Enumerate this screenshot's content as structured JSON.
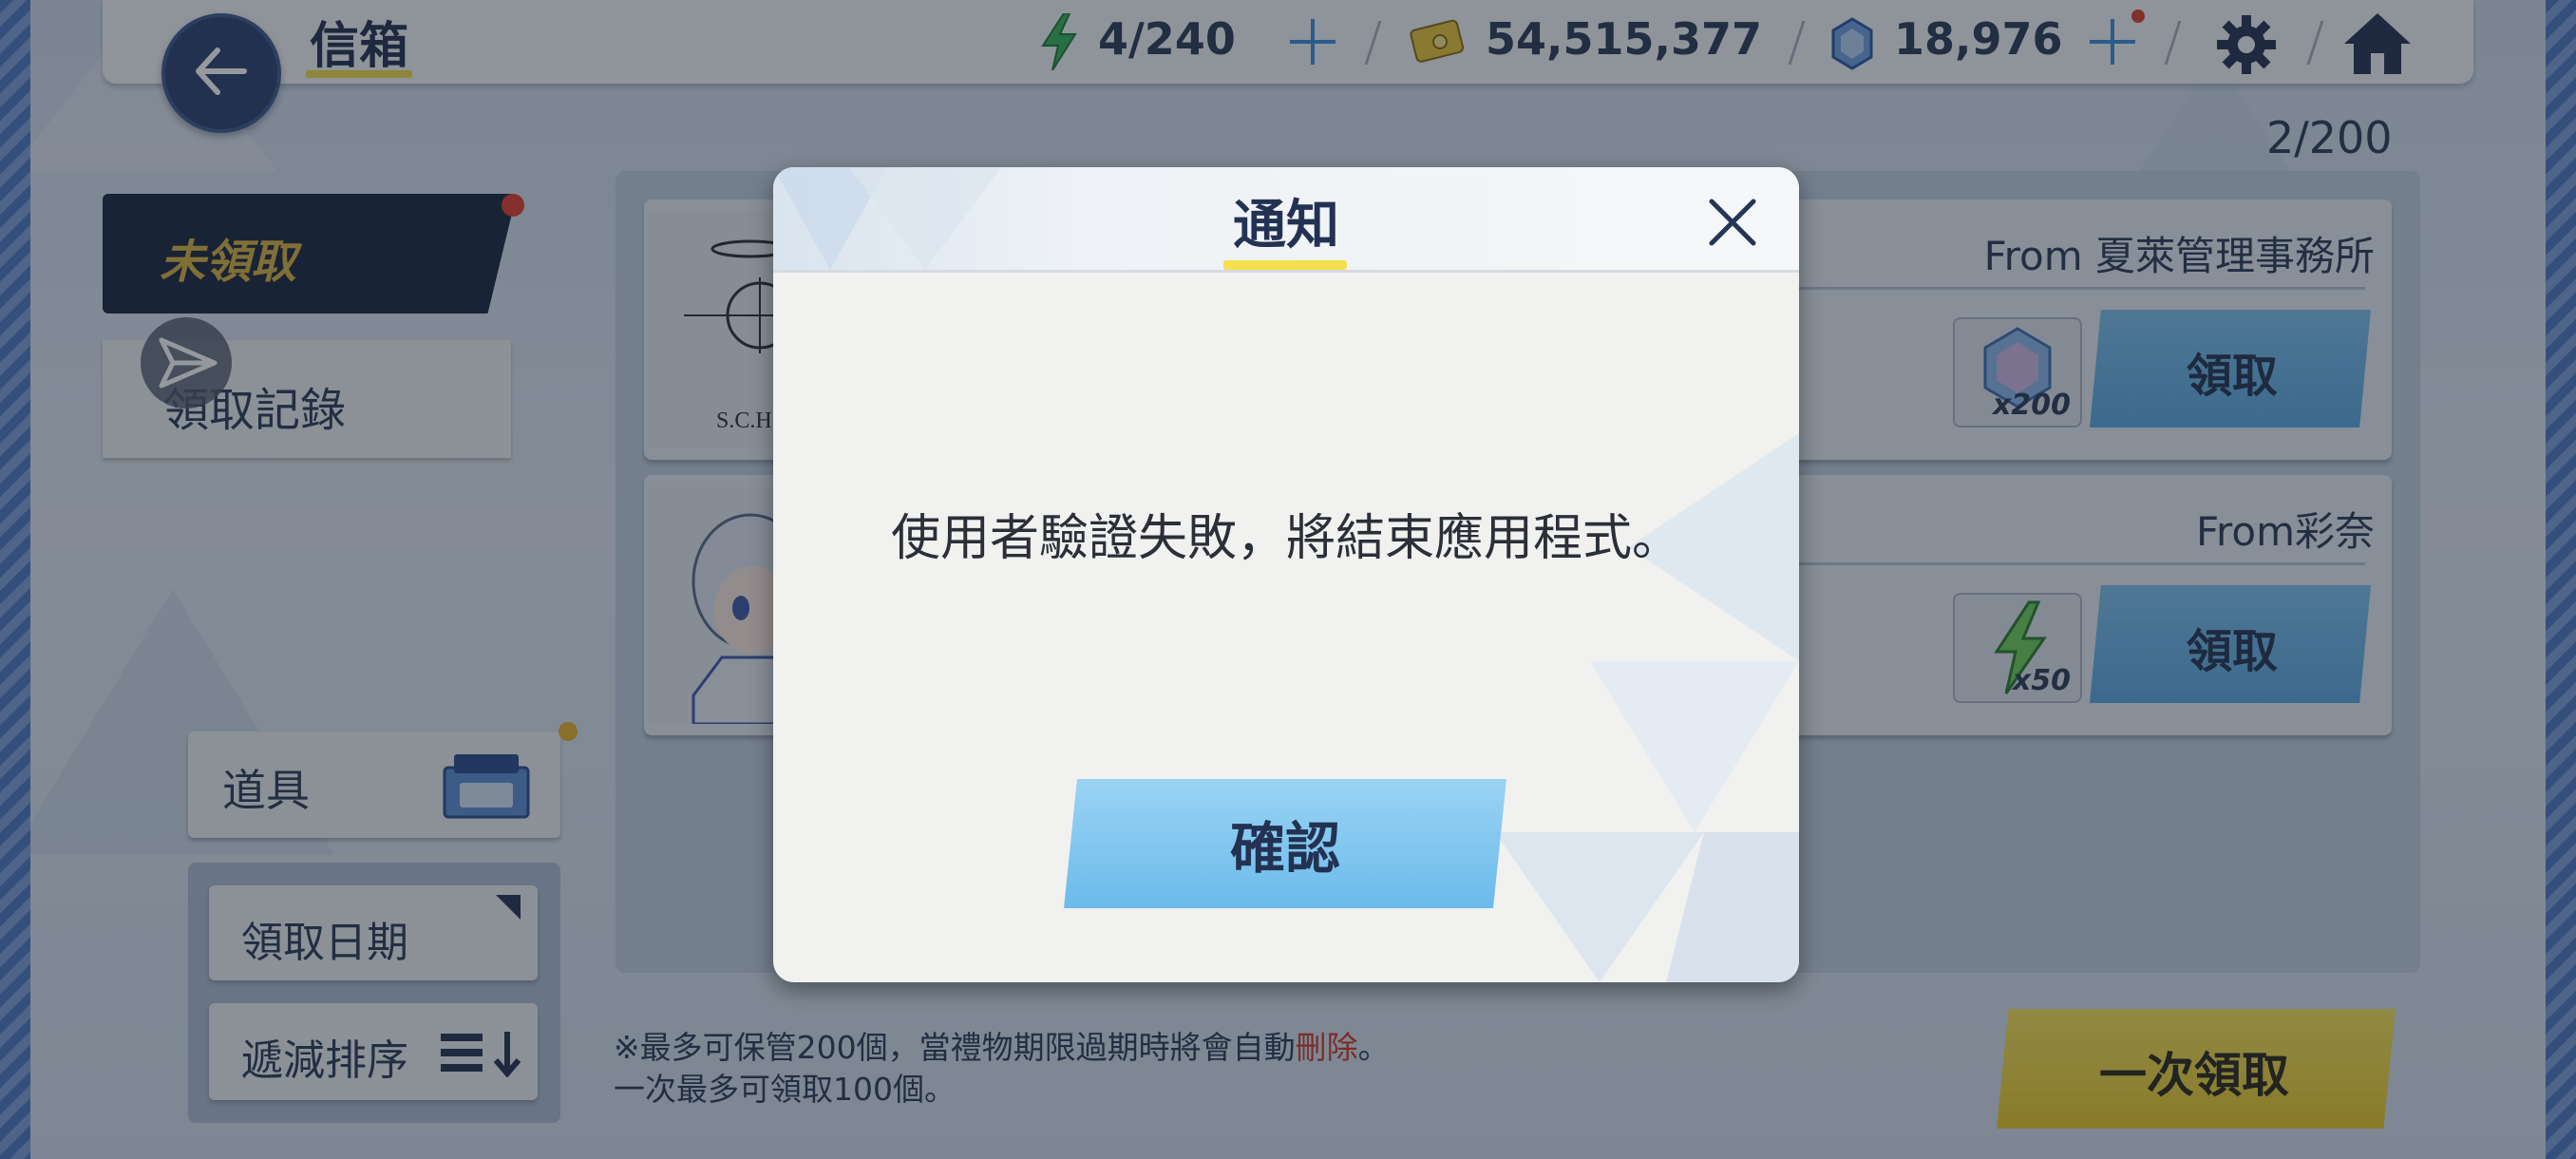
{
  "header": {
    "title": "信箱",
    "stamina": "4/240",
    "credits": "54,515,377",
    "gems": "18,976"
  },
  "tabs": {
    "unclaimed": "未領取",
    "history": "領取記錄"
  },
  "mail": {
    "count": "2/200",
    "items": [
      {
        "from": "From 夏萊管理事務所",
        "reward_count": "x200",
        "claim_label": "領取",
        "thumb_text": "S.C.H"
      },
      {
        "from": "From彩奈",
        "reward_count": "x50",
        "claim_label": "領取"
      }
    ]
  },
  "sidebar": {
    "items_label": "道具",
    "sort_date_label": "領取日期",
    "filter_sort_label": "遞減排序"
  },
  "footer": {
    "note_line1_a": "※最多可保管200個，當禮物期限過期時將會自動",
    "note_line1_red": "刪除",
    "note_line1_b": "。",
    "note_line2": "一次最多可領取100個。",
    "claim_all_label": "一次領取"
  },
  "dialog": {
    "title": "通知",
    "message": "使用者驗證失敗，將結束應用程式。",
    "confirm_label": "確認"
  },
  "colors": {
    "dark_navy": "#1b2842",
    "gold_text": "#d9b342",
    "claim_blue": "#5aa9e3",
    "claim_all_yellow": "#f2d63c",
    "accent_underline": "#f5e04d",
    "delete_red": "#d03a2d"
  }
}
